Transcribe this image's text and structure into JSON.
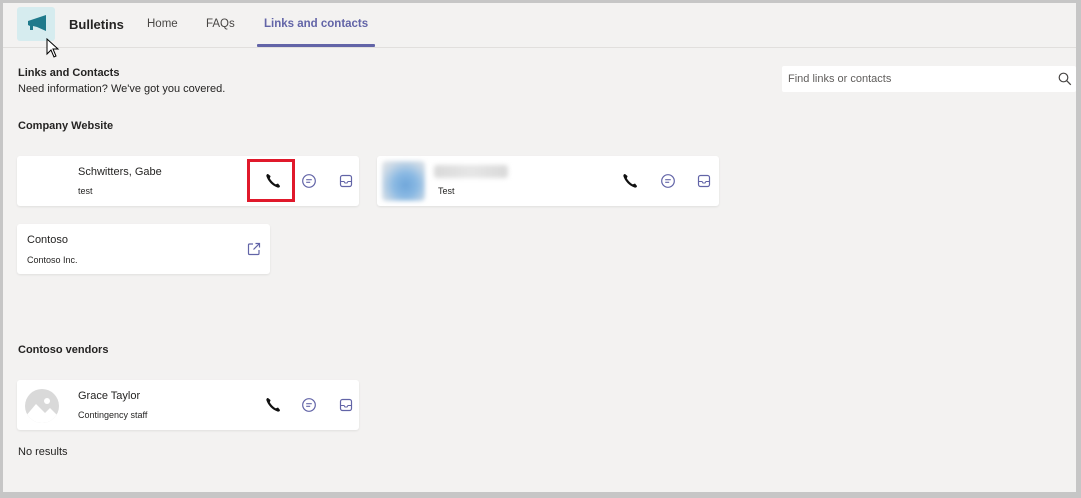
{
  "header": {
    "app_name": "Bulletins",
    "tabs": [
      {
        "label": "Home",
        "active": false
      },
      {
        "label": "FAQs",
        "active": false
      },
      {
        "label": "Links and contacts",
        "active": true
      }
    ]
  },
  "page": {
    "title": "Links and Contacts",
    "subtitle": "Need information? We've got you covered."
  },
  "search": {
    "placeholder": "Find links or contacts",
    "value": ""
  },
  "sections": [
    {
      "title": "Company Website",
      "contacts": [
        {
          "name": "Schwitters, Gabe",
          "detail": "test"
        },
        {
          "name": "",
          "detail": "Test"
        }
      ],
      "links": [
        {
          "name": "Contoso",
          "detail": "Contoso Inc."
        }
      ]
    },
    {
      "title": "Contoso vendors",
      "contacts": [
        {
          "name": "Grace Taylor",
          "detail": "Contingency staff"
        }
      ],
      "empty_text": "No results"
    }
  ],
  "icons": {
    "app": "megaphone-icon",
    "search": "search-icon",
    "call": "phone-icon",
    "chat": "chat-icon",
    "mail": "mail-icon",
    "open_link": "external-link-icon"
  },
  "colors": {
    "accent": "#6264a7",
    "highlight": "#e0192b",
    "app_icon_bg": "#d6ecef",
    "app_icon": "#1f7a8c"
  }
}
